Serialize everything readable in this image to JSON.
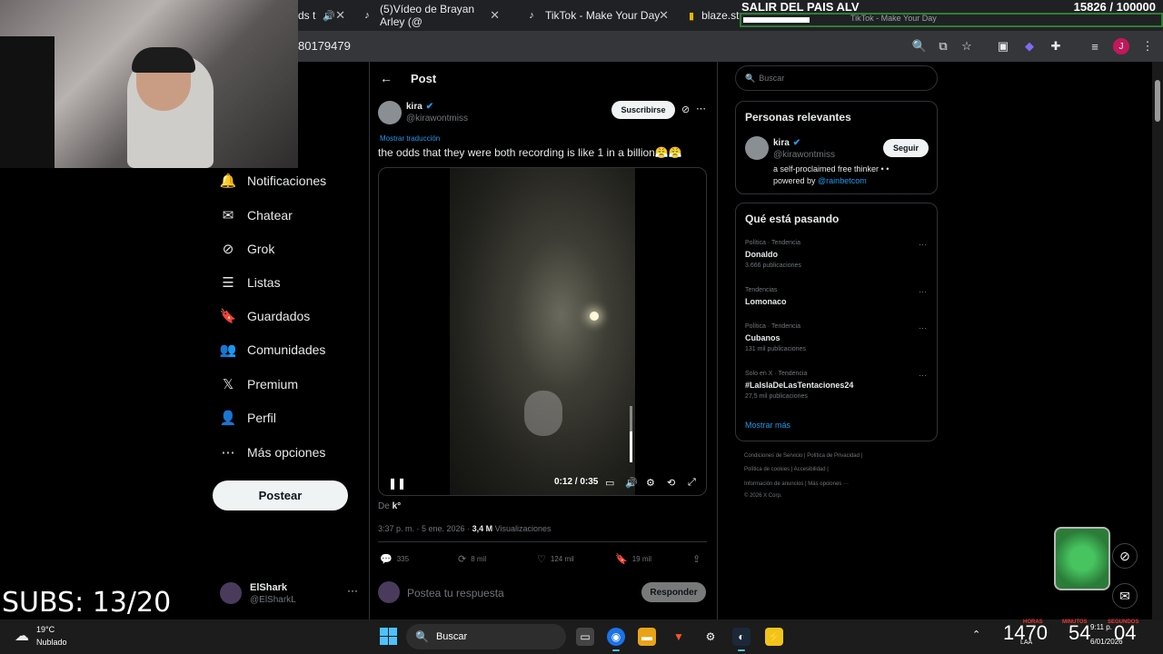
{
  "browser": {
    "tabs": [
      {
        "label": "ds t",
        "close": "✕"
      },
      {
        "label": "(5)Vídeo de Brayan Arley (@",
        "close": "✕"
      },
      {
        "label": "TikTok - Make Your Day",
        "close": "✕"
      },
      {
        "label": "blaze.stream",
        "close": ""
      }
    ],
    "url": "80179479",
    "profile_initial": "J"
  },
  "overlay": {
    "goal_title": "SALIR DEL PAIS ALV",
    "goal_count": "15826   / 100000",
    "goal_progress": 0.158,
    "ghost_tab": "TikTok - Make Your Day",
    "subs": "SUBS: 13/20"
  },
  "nav": {
    "items": [
      {
        "label": "Notificaciones",
        "icon": "bell-icon",
        "glyph": "🔔"
      },
      {
        "label": "Chatear",
        "icon": "mail-icon",
        "glyph": "✉"
      },
      {
        "label": "Grok",
        "icon": "grok-icon",
        "glyph": "⊘"
      },
      {
        "label": "Listas",
        "icon": "list-icon",
        "glyph": "☰"
      },
      {
        "label": "Guardados",
        "icon": "bookmark-icon",
        "glyph": "🔖"
      },
      {
        "label": "Comunidades",
        "icon": "community-icon",
        "glyph": "👥"
      },
      {
        "label": "Premium",
        "icon": "x-icon",
        "glyph": "𝕏"
      },
      {
        "label": "Perfil",
        "icon": "profile-icon",
        "glyph": "👤"
      },
      {
        "label": "Más opciones",
        "icon": "more-icon",
        "glyph": "⋯"
      }
    ],
    "post_button": "Postear",
    "user": {
      "name": "ElShark",
      "handle": "@ElSharkL",
      "menu": "···"
    }
  },
  "post": {
    "header": "Post",
    "author": {
      "name": "kira",
      "handle": "@kirawontmiss"
    },
    "subscribe": "Suscribirse",
    "translate": "Mostrar traducción",
    "text": "the odds that they were both recording is like 1 in a billion😤😤",
    "video": {
      "time": "0:12 / 0:35",
      "volume": 0.55
    },
    "from_label": "De",
    "from_value": "k°",
    "timestamp": "3:37 p. m. · 5 ene. 2026 ·",
    "views_count": "3,4 M",
    "views_label": "Visualizaciones",
    "stats": {
      "replies": "335",
      "reposts": "8 mil",
      "likes": "124 mil",
      "bookmarks": "19 mil"
    },
    "reply_placeholder": "Postea tu respuesta",
    "reply_button": "Responder"
  },
  "sidebar": {
    "search_placeholder": "Buscar",
    "relevant": {
      "title": "Personas relevantes",
      "name": "kira",
      "handle": "@kirawontmiss",
      "follow": "Seguir",
      "bio": "a self-proclaimed free thinker • •",
      "bio_prefix": "powered by",
      "bio_link": "@rainbetcom"
    },
    "trends": {
      "title": "Qué está pasando",
      "items": [
        {
          "category": "Política · Tendencia",
          "name": "Donaldo",
          "count": "3.666 publicaciones"
        },
        {
          "category": "Tendencias",
          "name": "Lomonaco",
          "count": ""
        },
        {
          "category": "Política · Tendencia",
          "name": "Cubanos",
          "count": "131 mil publicaciones"
        },
        {
          "category": "Solo en X · Tendencia",
          "name": "#LaIslaDeLasTentaciones24",
          "count": "27,5 mil publicaciones"
        }
      ],
      "show_more": "Mostrar más"
    },
    "footer": [
      "Condiciones de Servicio  |  Política de Privacidad  |",
      "Política de cookies  |  Accesibilidad  |",
      "Información de anuncios  |  Más opciones ···",
      "© 2026 X Corp."
    ]
  },
  "taskbar": {
    "temp": "19°C",
    "weather": "Nublado",
    "search": "Buscar",
    "timer_hours": "1470",
    "timer_minutes": "54",
    "timer_seconds": "04",
    "timer_labels": [
      "HORAS",
      "MINUTOS",
      "SEGUNDOS"
    ],
    "time": "9:11 p.",
    "date": "6/01/2026",
    "lang": "LAA"
  }
}
